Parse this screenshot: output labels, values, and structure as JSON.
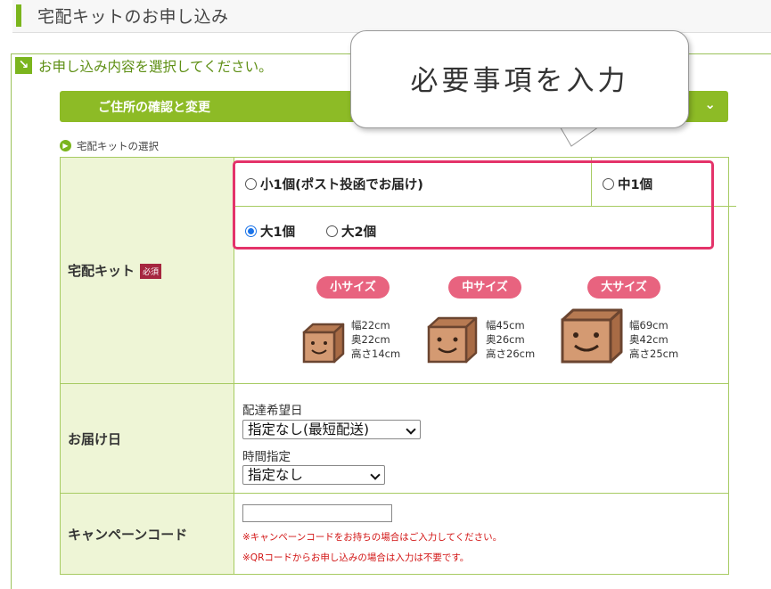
{
  "header": {
    "title": "宅配キットのお申し込み"
  },
  "section": {
    "title": "お申し込み内容を選択してください。"
  },
  "address_bar": {
    "label": "ご住所の確認と変更"
  },
  "kit_select": {
    "title": "宅配キットの選択"
  },
  "callout": {
    "text": "必要事項を入力"
  },
  "colors": {
    "accent_green": "#8dbb26",
    "highlight_pink": "#e4336a",
    "required_badge": "#a5263f",
    "note_red": "#d21414"
  },
  "kit": {
    "label": "宅配キット",
    "required_badge": "必須",
    "options": [
      {
        "label": "小1個(ポスト投函でお届け)",
        "checked": false
      },
      {
        "label": "中1個",
        "checked": false
      },
      {
        "label": "大1個",
        "checked": true
      },
      {
        "label": "大2個",
        "checked": false
      }
    ],
    "sizes": [
      {
        "name": "小サイズ",
        "width": "幅22cm",
        "depth": "奥22cm",
        "height": "高さ14cm"
      },
      {
        "name": "中サイズ",
        "width": "幅45cm",
        "depth": "奥26cm",
        "height": "高さ26cm"
      },
      {
        "name": "大サイズ",
        "width": "幅69cm",
        "depth": "奥42cm",
        "height": "高さ25cm"
      }
    ]
  },
  "delivery": {
    "label": "お届け日",
    "date_label": "配達希望日",
    "date_value": "指定なし(最短配送)",
    "time_label": "時間指定",
    "time_value": "指定なし"
  },
  "campaign": {
    "label": "キャンペーンコード",
    "input_value": "",
    "note1": "※キャンペーンコードをお持ちの場合はご入力してください。",
    "note2": "※QRコードからお申し込みの場合は入力は不要です。"
  }
}
